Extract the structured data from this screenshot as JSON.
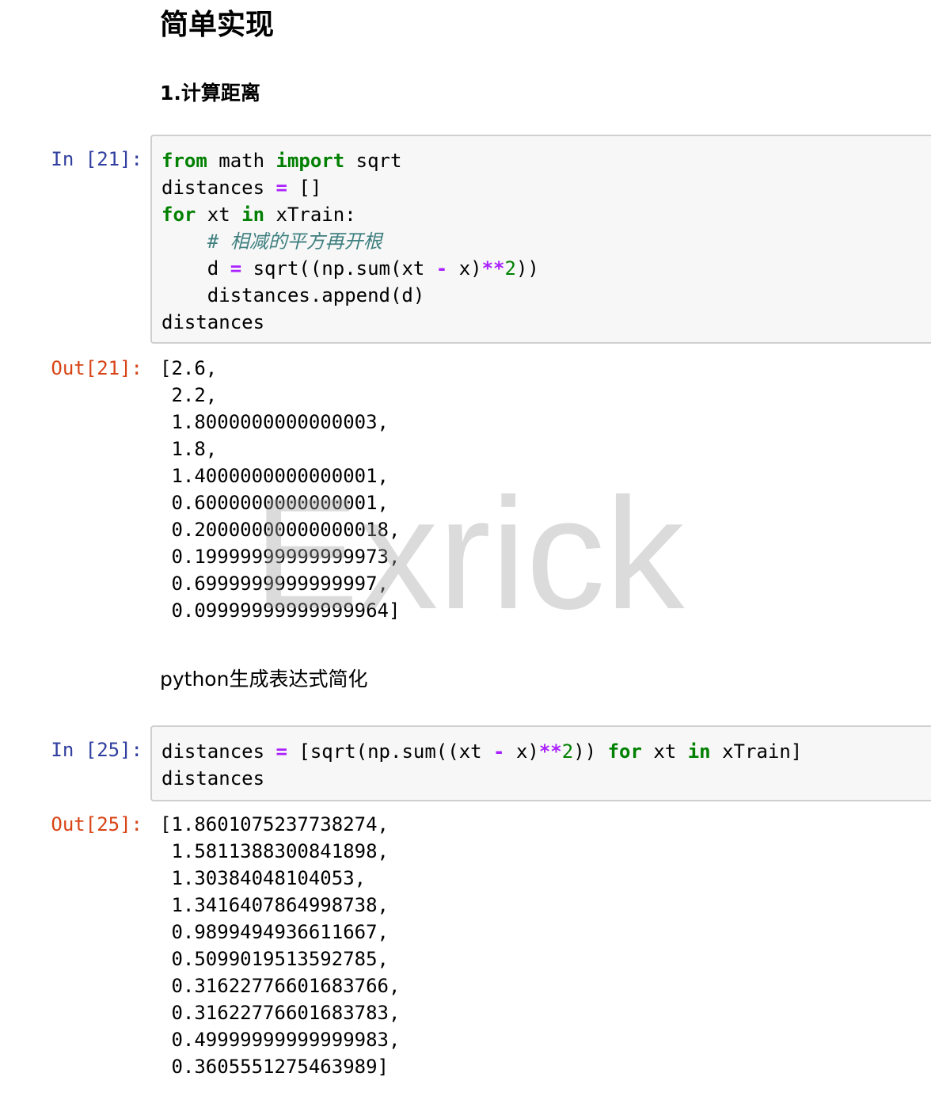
{
  "headings": {
    "h1": "简单实现",
    "h2": "1.计算距离"
  },
  "cell1": {
    "prompt_in": "In [21]:",
    "code": {
      "l1_kw1": "from",
      "l1_t1": " math ",
      "l1_kw2": "import",
      "l1_t2": " sqrt",
      "l2_t1": "distances ",
      "l2_op1": "=",
      "l2_t2": " []",
      "l3_kw1": "for",
      "l3_t1": " xt ",
      "l3_kw2": "in",
      "l3_t2": " xTrain:",
      "l4_indent": "    ",
      "l4_comment": "# 相减的平方再开根",
      "l5_t1": "    d ",
      "l5_op1": "=",
      "l5_t2": " sqrt((np.sum(xt ",
      "l5_op2": "-",
      "l5_t3": " x)",
      "l5_op3": "**",
      "l5_num": "2",
      "l5_t4": "))",
      "l6": "    distances.append(d)",
      "l7": "distances"
    },
    "prompt_out": "Out[21]:",
    "output": "[2.6,\n 2.2,\n 1.8000000000000003,\n 1.8,\n 1.4000000000000001,\n 0.6000000000000001,\n 0.20000000000000018,\n 0.19999999999999973,\n 0.6999999999999997,\n 0.09999999999999964]"
  },
  "markdown_text": "python生成表达式简化",
  "cell2": {
    "prompt_in": "In [25]:",
    "code": {
      "l1_t1": "distances ",
      "l1_op1": "=",
      "l1_t2": " [sqrt(np.sum((xt ",
      "l1_op2": "-",
      "l1_t3": " x)",
      "l1_op3": "**",
      "l1_num": "2",
      "l1_t4": ")) ",
      "l1_kw1": "for",
      "l1_t5": " xt ",
      "l1_kw2": "in",
      "l1_t6": " xTrain]",
      "l2": "distances"
    },
    "prompt_out": "Out[25]:",
    "output": "[1.8601075237738274,\n 1.5811388300841898,\n 1.30384048104053,\n 1.3416407864998738,\n 0.9899494936611667,\n 0.5099019513592785,\n 0.31622776601683766,\n 0.31622776601683783,\n 0.49999999999999983,\n 0.3605551275463989]"
  },
  "watermark": "Exrick",
  "colors": {
    "prompt_in": "#303F9F",
    "prompt_out": "#D84315",
    "keyword": "#008000",
    "operator": "#AA22FF",
    "comment": "#408080",
    "cell_background": "#f7f7f7",
    "cell_border": "#cfcfcf"
  }
}
